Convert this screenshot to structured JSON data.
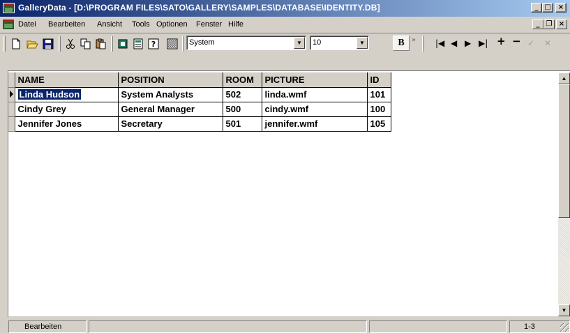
{
  "window": {
    "title": "GalleryData - [D:\\PROGRAM FILES\\SATO\\GALLERY\\SAMPLES\\DATABASE\\IDENTITY.DB]",
    "minimize": "_",
    "maximize": "□",
    "close": "×"
  },
  "menu": {
    "items": [
      "Datei",
      "Bearbeiten",
      "Ansicht",
      "Tools",
      "Optionen",
      "Fenster",
      "Hilfe"
    ],
    "mdi_min": "_",
    "mdi_restore": "❐",
    "mdi_close": "×"
  },
  "toolbar": {
    "font_name": "System",
    "font_size": "10",
    "bold_label": "B",
    "overflow": "»",
    "icons": [
      "new-document-icon",
      "open-folder-icon",
      "save-disk-icon",
      "cut-icon",
      "copy-icon",
      "paste-icon",
      "grid-view-icon",
      "form-view-icon",
      "help-icon",
      "image-icon"
    ],
    "nav": {
      "first": "|◀",
      "prev": "◀",
      "next": "▶",
      "last": "▶|",
      "add": "+",
      "delete": "−",
      "post": "✓",
      "cancel": "✕"
    }
  },
  "grid": {
    "columns": [
      "NAME",
      "POSITION",
      "ROOM",
      "PICTURE",
      "ID"
    ],
    "rows": [
      [
        "Linda Hudson",
        "System Analysts",
        "502",
        "linda.wmf",
        "101"
      ],
      [
        "Cindy Grey",
        "General Manager",
        "500",
        "cindy.wmf",
        "100"
      ],
      [
        "Jennifer Jones",
        "Secretary",
        "501",
        "jennifer.wmf",
        "105"
      ]
    ],
    "current_row": 0
  },
  "scrollbar": {
    "up": "▲",
    "down": "▼"
  },
  "status": {
    "mode": "Bearbeiten",
    "record_range": "1-3"
  },
  "colors": {
    "title_start": "#0a246a",
    "title_end": "#a6caf0",
    "selection": "#0a246a",
    "chrome": "#d4d0c8"
  }
}
